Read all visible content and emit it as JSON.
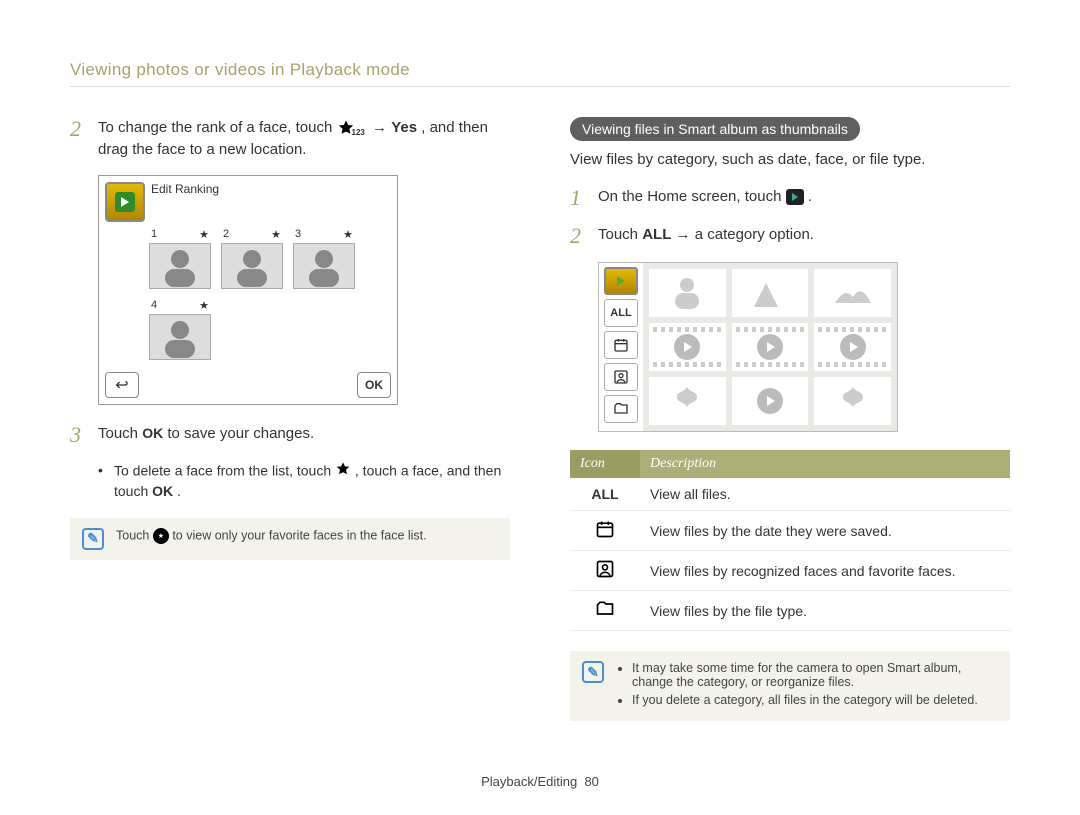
{
  "header": {
    "title": "Viewing photos or videos in Playback mode"
  },
  "left": {
    "step2": {
      "num": "2",
      "text_a": "To change the rank of a face, touch ",
      "text_b": " → ",
      "text_c": "Yes",
      "text_d": ", and then drag the face to a new location."
    },
    "screen1": {
      "title": "Edit Ranking",
      "ranks": [
        "1",
        "2",
        "3",
        "4"
      ],
      "ok": "OK"
    },
    "step3": {
      "num": "3",
      "text_a": "Touch ",
      "ok": "OK",
      "text_b": " to save your changes."
    },
    "bullet1": {
      "text_a": "To delete a face from the list, touch ",
      "text_b": ", touch a face, and then touch ",
      "ok": "OK",
      "text_c": "."
    },
    "tip": {
      "text_a": "Touch ",
      "text_b": " to view only your favorite faces in the face list."
    }
  },
  "right": {
    "pill": "Viewing files in Smart album as thumbnails",
    "desc": "View files by category, such as date, face, or file type.",
    "step1": {
      "num": "1",
      "text_a": "On the Home screen, touch ",
      "text_b": "."
    },
    "step2": {
      "num": "2",
      "text_a": "Touch ",
      "all": "ALL",
      "text_b": " → a category option."
    },
    "sideLabels": {
      "all": "ALL"
    },
    "table": {
      "head_icon": "Icon",
      "head_desc": "Description",
      "rows": [
        {
          "icon": "ALL",
          "desc": "View all files."
        },
        {
          "icon": "calendar",
          "desc": "View files by the date they were saved."
        },
        {
          "icon": "face",
          "desc": "View files by recognized faces and favorite faces."
        },
        {
          "icon": "folder",
          "desc": "View files by the file type."
        }
      ]
    },
    "tip": {
      "items": [
        "It may take some time for the camera to open Smart album, change the category, or reorganize files.",
        "If you delete a category, all files in the category will be deleted."
      ]
    }
  },
  "footer": {
    "section": "Playback/Editing",
    "page": "80"
  }
}
